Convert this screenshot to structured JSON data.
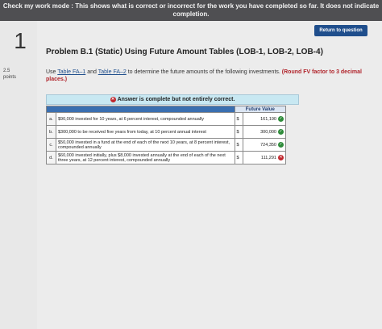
{
  "banner": {
    "line1": "Check my work mode : This shows what is correct or incorrect for the work you have completed so far. It does not indicate",
    "line2": "completion."
  },
  "question": {
    "number": "1",
    "points_value": "2.5",
    "points_label": "points"
  },
  "return_button": "Return to question",
  "title": "Problem B.1 (Static) Using Future Amount Tables (LOB-1, LOB-2, LOB-4)",
  "instructions": {
    "prefix": "Use ",
    "link1": "Table FA–1",
    "mid": " and ",
    "link2": "Table FA–2",
    "suffix": " to determine the future amounts of the following investments. ",
    "note": "(Round FV factor to 3 decimal places.)"
  },
  "answer_status": "Answer is complete but not entirely correct.",
  "table": {
    "header": "Future Value",
    "rows": [
      {
        "letter": "a.",
        "desc": "$90,000 invested for 10 years, at 6 percent interest, compounded annually",
        "dollar": "$",
        "value": "161,190",
        "status": "correct"
      },
      {
        "letter": "b.",
        "desc": "$300,000 to be received five years from today, at 10 percent annual interest",
        "dollar": "$",
        "value": "300,000",
        "status": "correct"
      },
      {
        "letter": "c.",
        "desc": "$50,000 invested in a fund at the end of each of the next 10 years, at 8 percent interest, compounded annually",
        "dollar": "$",
        "value": "724,350",
        "status": "correct"
      },
      {
        "letter": "d.",
        "desc": "$60,000 invested initially, plus $8,000 invested annually at the end of each of the next three years, at 12 percent interest, compounded annually",
        "dollar": "$",
        "value": "111,291",
        "status": "incorrect"
      }
    ]
  },
  "colors": {
    "banner": "#4f4f52",
    "button": "#1f4e8c",
    "correct": "#2e8b3a",
    "incorrect": "#c0282e"
  }
}
